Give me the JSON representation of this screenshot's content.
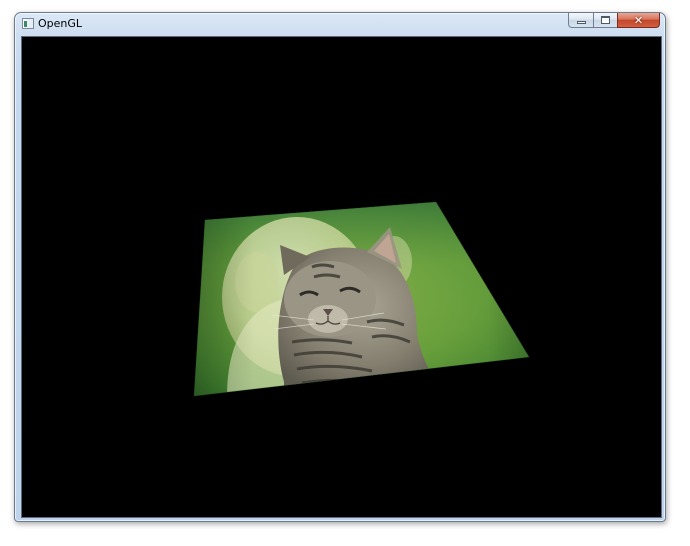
{
  "window": {
    "title": "OpenGL",
    "icon": "opengl-app-icon"
  },
  "caption_buttons": {
    "minimize_icon": "minimize-icon",
    "maximize_icon": "maximize-icon",
    "close_icon": "close-icon",
    "close_glyph": "✕"
  },
  "viewport": {
    "background": "#000000",
    "texture": {
      "description_colors": {
        "grass_light": "#9cc04a",
        "grass_dark": "#2f6a2a",
        "dog_fur": "#d8e0b0",
        "cat_fur": "#7d7a70",
        "cat_stripes": "#3b3a35"
      },
      "icon": "textured-quad-icon"
    }
  }
}
